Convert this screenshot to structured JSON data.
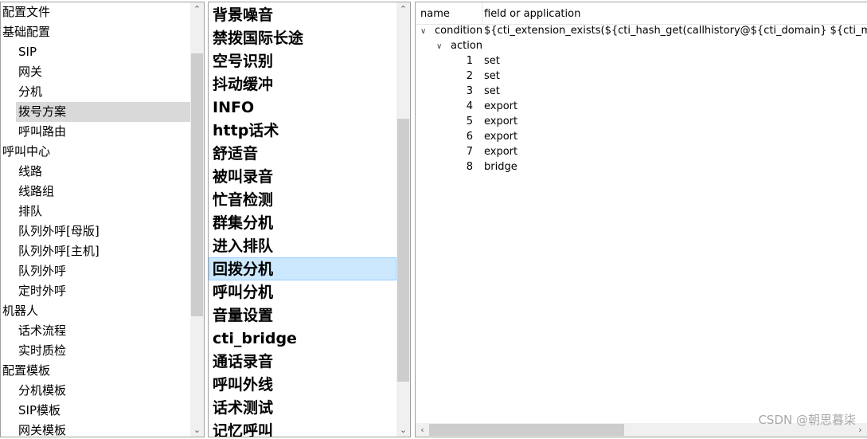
{
  "left_tree": {
    "items": [
      {
        "label": "配置文件",
        "level": 0
      },
      {
        "label": "基础配置",
        "level": 0
      },
      {
        "label": "SIP",
        "level": 1
      },
      {
        "label": "网关",
        "level": 1
      },
      {
        "label": "分机",
        "level": 1
      },
      {
        "label": "拨号方案",
        "level": 1,
        "selected": true
      },
      {
        "label": "呼叫路由",
        "level": 1
      },
      {
        "label": "呼叫中心",
        "level": 0
      },
      {
        "label": "线路",
        "level": 1
      },
      {
        "label": "线路组",
        "level": 1
      },
      {
        "label": "排队",
        "level": 1
      },
      {
        "label": "队列外呼[母版]",
        "level": 1
      },
      {
        "label": "队列外呼[主机]",
        "level": 1
      },
      {
        "label": "队列外呼",
        "level": 1
      },
      {
        "label": "定时外呼",
        "level": 1
      },
      {
        "label": "机器人",
        "level": 0
      },
      {
        "label": "话术流程",
        "level": 1
      },
      {
        "label": "实时质检",
        "level": 1
      },
      {
        "label": "配置模板",
        "level": 0
      },
      {
        "label": "分机模板",
        "level": 1
      },
      {
        "label": "SIP模板",
        "level": 1
      },
      {
        "label": "网关模板",
        "level": 1
      }
    ]
  },
  "middle_list": {
    "items": [
      {
        "label": "背景噪音"
      },
      {
        "label": "禁拨国际长途"
      },
      {
        "label": "空号识别"
      },
      {
        "label": "抖动缓冲"
      },
      {
        "label": "INFO"
      },
      {
        "label": "http话术"
      },
      {
        "label": "舒适音"
      },
      {
        "label": "被叫录音"
      },
      {
        "label": "忙音检测"
      },
      {
        "label": "群集分机"
      },
      {
        "label": "进入排队"
      },
      {
        "label": "回拨分机",
        "selected": true
      },
      {
        "label": "呼叫分机"
      },
      {
        "label": "音量设置"
      },
      {
        "label": "cti_bridge"
      },
      {
        "label": "通话录音"
      },
      {
        "label": "呼叫外线"
      },
      {
        "label": "话术测试"
      },
      {
        "label": "记忆呼叫"
      }
    ]
  },
  "detail_tree": {
    "columns": [
      "name",
      "field or application"
    ],
    "condition": {
      "name": "condition",
      "value": "${cti_extension_exists(${cti_hash_get(callhistory@${cti_domain} ${cti_mid_string(${call"
    },
    "action": {
      "name": "action"
    },
    "actions": [
      {
        "num": "1",
        "app": "set"
      },
      {
        "num": "2",
        "app": "set"
      },
      {
        "num": "3",
        "app": "set"
      },
      {
        "num": "4",
        "app": "export"
      },
      {
        "num": "5",
        "app": "export"
      },
      {
        "num": "6",
        "app": "export"
      },
      {
        "num": "7",
        "app": "export"
      },
      {
        "num": "8",
        "app": "bridge"
      }
    ]
  },
  "icons": {
    "expand": "chevron-down-icon",
    "scroll_up": "scroll-up-arrow-icon",
    "scroll_down": "scroll-down-arrow-icon",
    "scroll_left": "scroll-left-arrow-icon",
    "scroll_right": "scroll-right-arrow-icon"
  },
  "watermark": "CSDN @朝思暮柒",
  "colors": {
    "selected_gray": "#d9d9d9",
    "selected_blue": "#cce8ff",
    "selected_blue_border": "#99d1ff",
    "scroll_thumb": "#cdcdcd"
  }
}
